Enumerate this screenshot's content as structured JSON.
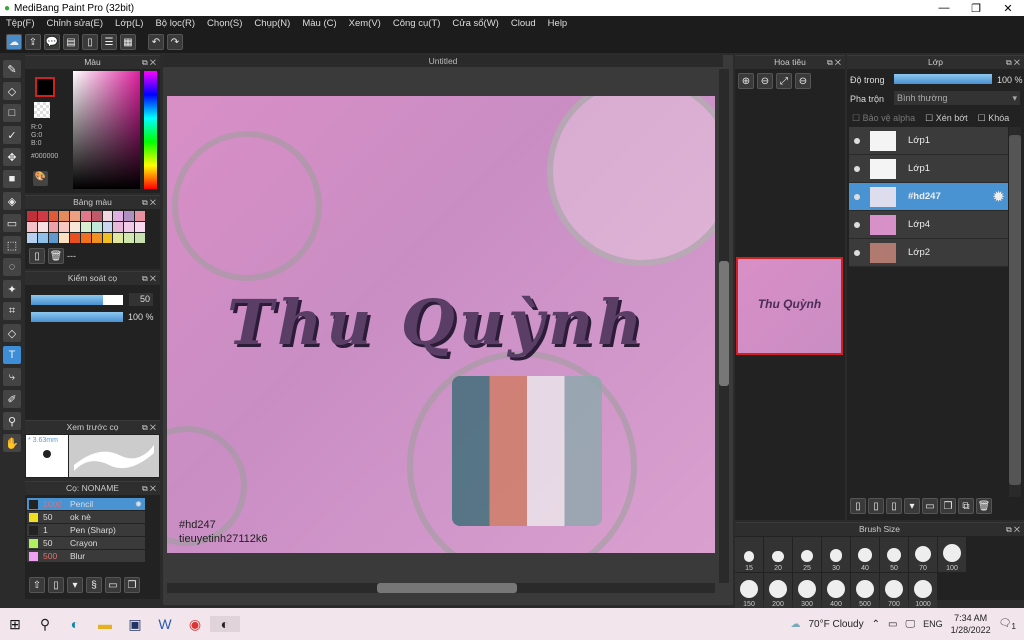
{
  "window": {
    "title": "MediBang Paint Pro (32bit)"
  },
  "menu": [
    "Tệp(F)",
    "Chỉnh sửa(E)",
    "Lớp(L)",
    "Bộ lọc(R)",
    "Chọn(S)",
    "Chụp(N)",
    "Màu (C)",
    "Xem(V)",
    "Công cụ(T)",
    "Cửa sổ(W)",
    "Cloud",
    "Help"
  ],
  "color_panel": {
    "title": "Màu",
    "r": "R:0",
    "g": "G:0",
    "b": "B:0",
    "hex": "#000000"
  },
  "palette_panel": {
    "title": "Bảng màu",
    "more": "---",
    "swatches": [
      "#c0303a",
      "#d03a45",
      "#e05a3a",
      "#e58a5a",
      "#eea080",
      "#e07a8a",
      "#c05a6a",
      "#f0d8e0",
      "#e0b0e0",
      "#b090c0",
      "#e890a0",
      "#f5c0c8",
      "#f8e0e0",
      "#f0a0a8",
      "#f8c8c0",
      "#f8e8d8",
      "#d8f0d0",
      "#c0e8d8",
      "#c8d8f0",
      "#e8b8d8",
      "#f0c8e8",
      "#f8d8f0",
      "#b8d0f0",
      "#90c0e8",
      "#6098d0",
      "#f8e0c0",
      "#e85020",
      "#f07020",
      "#f09020",
      "#f0c020",
      "#e0e8a0",
      "#d0e8b0",
      "#c8e0b0"
    ]
  },
  "brush_control": {
    "title": "Kiểm soát cọ",
    "size": "50",
    "opacity": "100 %",
    "size_fraction": 0.78,
    "opacity_fraction": 1.0
  },
  "brush_preview": {
    "title": "Xem trước cọ",
    "size": "* 3.63mm"
  },
  "brush_list": {
    "title": "Cọ: NONAME",
    "items": [
      {
        "size": "1000",
        "name": "Pencil",
        "color": "#222",
        "selected": true
      },
      {
        "size": "50",
        "name": "ok nè",
        "color": "#f0e020"
      },
      {
        "size": "1",
        "name": "Pen (Sharp)",
        "color": "#222"
      },
      {
        "size": "50",
        "name": "Crayon",
        "color": "#b0f060"
      },
      {
        "size": "500",
        "name": "Blur",
        "color": "#f0a0f0"
      }
    ]
  },
  "canvas": {
    "tab": "Untitled",
    "caption1": "#hd247",
    "caption2": "tieuyetinh27112k6",
    "art_title": "Thu Quỳnh"
  },
  "navigator": {
    "title": "Hoa tiêu"
  },
  "layers": {
    "title": "Lớp",
    "opacity_label": "Độ trong",
    "opacity_value": "100 %",
    "opacity_fraction": 1.0,
    "blend_label": "Pha trộn",
    "blend_value": "Bình thường",
    "protect_alpha": "Bảo vệ alpha",
    "clip": "Xén bớt",
    "lock": "Khóa",
    "items": [
      {
        "name": "Lớp1"
      },
      {
        "name": "Lớp1"
      },
      {
        "name": "#hd247",
        "selected": true
      },
      {
        "name": "Lớp4"
      },
      {
        "name": "Lớp2"
      }
    ]
  },
  "brush_size": {
    "title": "Brush Size",
    "sizes": [
      "15",
      "20",
      "25",
      "30",
      "40",
      "50",
      "70",
      "100",
      "150",
      "200",
      "300",
      "400",
      "500",
      "700",
      "1000"
    ]
  },
  "taskbar": {
    "weather": "70°F  Cloudy",
    "lang": "ENG",
    "time": "7:34 AM",
    "date": "1/28/2022",
    "notif": "1"
  }
}
